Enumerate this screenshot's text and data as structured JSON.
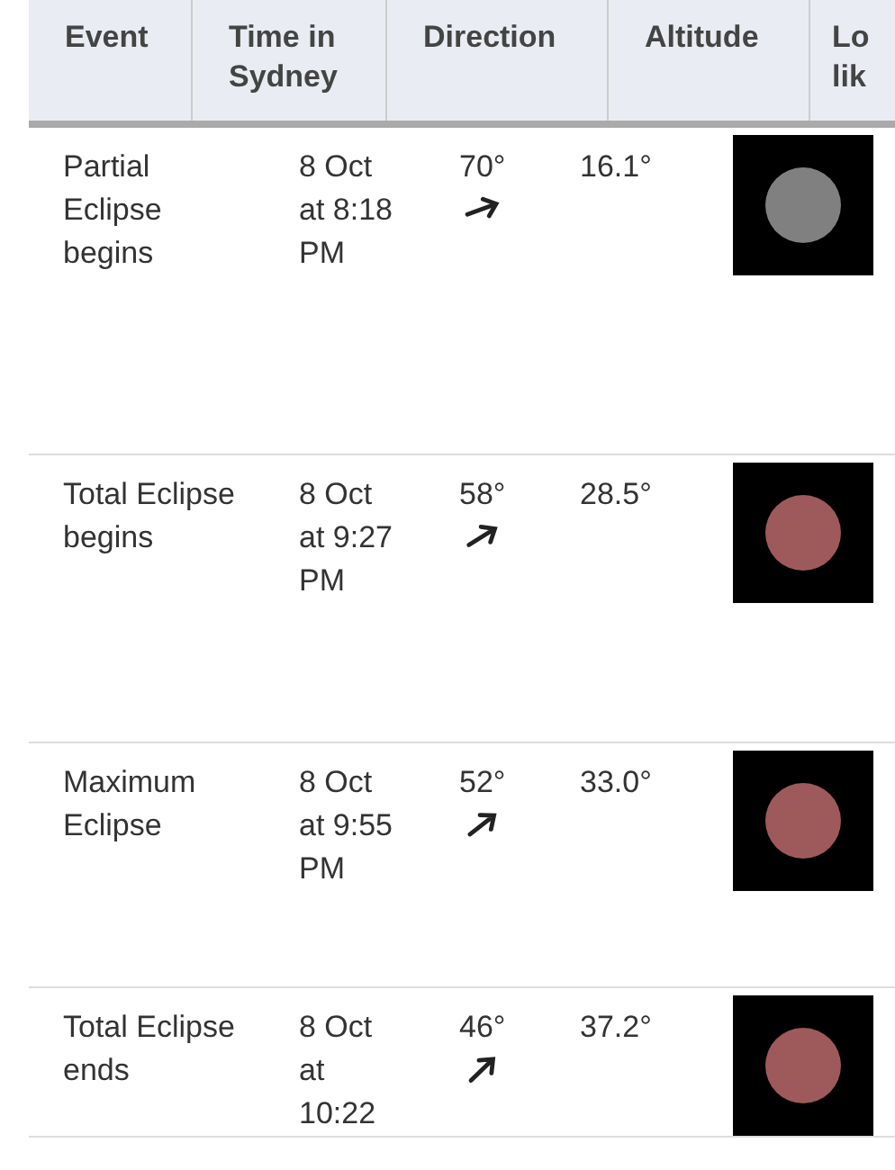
{
  "table": {
    "columns": [
      "Event",
      "Time in Sydney",
      "Direction",
      "Altitude",
      "Lo lik"
    ],
    "rows": [
      {
        "event": "Partial Eclipse begins",
        "time": "8 Oct at 8:18 PM",
        "direction": "70°",
        "altitude": "16.1°",
        "color": "#808080"
      },
      {
        "event": "Total Eclipse begins",
        "time": "8 Oct at 9:27 PM",
        "direction": "58°",
        "altitude": "28.5°",
        "color": "#9e5a5a"
      },
      {
        "event": "Maximum Eclipse",
        "time": "8 Oct at 9:55 PM",
        "direction": "52°",
        "altitude": "33.0°",
        "color": "#9e5a5a"
      },
      {
        "event": "Total Eclipse ends",
        "time": "8 Oct at 10:22",
        "direction": "46°",
        "altitude": "37.2°",
        "color": "#9e5a5a"
      }
    ]
  }
}
